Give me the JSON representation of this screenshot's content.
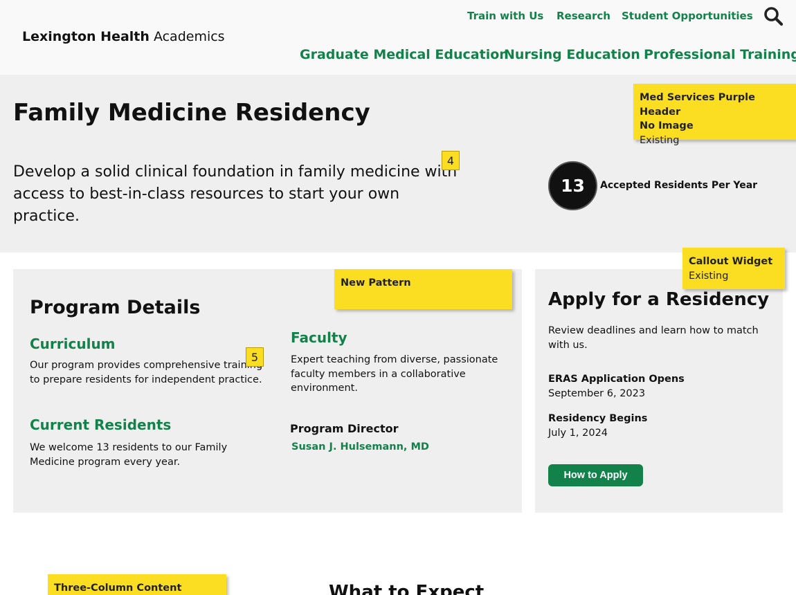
{
  "header": {
    "logo_bold": "Lexington Health",
    "logo_regular": " Academics",
    "utility_nav": [
      "Train with Us",
      "Research",
      "Student Opportunities"
    ],
    "main_nav": [
      "Graduate Medical Education",
      "Nursing Education",
      "Professional Training"
    ],
    "search_icon": "search-icon"
  },
  "hero": {
    "title": "Family Medicine Residency",
    "description": "Develop a solid clinical foundation in family medicine with access to best-in-class resources to start your own practice.",
    "stat_value": "13",
    "stat_label": "Accepted Residents Per Year"
  },
  "details": {
    "title": "Program Details",
    "curriculum_title": "Curriculum",
    "curriculum_text": "Our program provides comprehensive training to prepare residents for independent practice.",
    "residents_title": "Current Residents",
    "residents_text": "We welcome 13 residents to our Family Medicine program every year.",
    "faculty_title": "Faculty",
    "faculty_text": "Expert teaching from diverse, passionate faculty members in a collaborative environment.",
    "director_label": "Program Director",
    "director_name": "Susan J. Hulsemann, MD"
  },
  "apply": {
    "title": "Apply for a Residency",
    "description": "Review deadlines and learn how to match with us.",
    "date1_label": "ERAS Application Opens",
    "date1_value": "September 6, 2023",
    "date2_label": "Residency Begins",
    "date2_value": "July 1, 2024",
    "button_label": "How to Apply"
  },
  "next_section": {
    "title": "What to Expect"
  },
  "annotations": {
    "note1_line1": "Med Services Purple Header",
    "note1_line2": "No Image",
    "note1_line3": "Existing",
    "note2_line1": "Callout Widget",
    "note2_line2": "Existing",
    "note3_line1": "New Pattern",
    "note4_line1": "Three-Column Content Blocks",
    "marker4": "4",
    "marker5": "5"
  },
  "colors": {
    "accent_green": "#13824a",
    "note_yellow": "#fbdd22",
    "panel_gray": "#efefef"
  }
}
